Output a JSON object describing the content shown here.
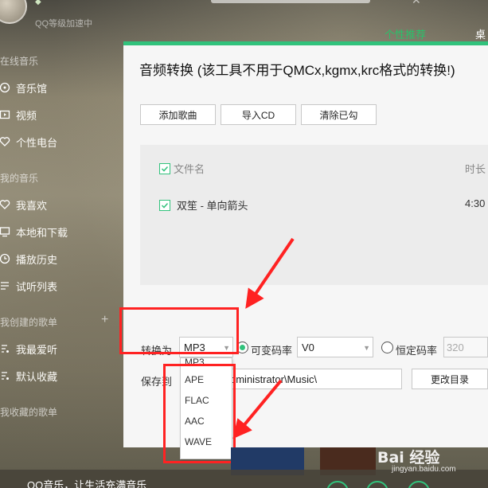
{
  "sidebar": {
    "vip_text": "QQ等级加速中",
    "sections": {
      "online": "在线音乐",
      "mine": "我的音乐",
      "created": "我创建的歌单",
      "collected": "我收藏的歌单"
    },
    "items": [
      {
        "label": "音乐馆",
        "icon": "music-hall-icon"
      },
      {
        "label": "视频",
        "icon": "video-icon"
      },
      {
        "label": "个性电台",
        "icon": "heart-radio-icon"
      },
      {
        "label": "我喜欢",
        "icon": "heart-icon"
      },
      {
        "label": "本地和下载",
        "icon": "monitor-icon"
      },
      {
        "label": "播放历史",
        "icon": "clock-icon"
      },
      {
        "label": "试听列表",
        "icon": "list-icon"
      },
      {
        "label": "我最爱听",
        "icon": "playlist-icon"
      },
      {
        "label": "默认收藏",
        "icon": "playlist-icon"
      }
    ]
  },
  "top": {
    "tab_recommend": "个性推荐",
    "tab_desktop": "桌"
  },
  "dialog": {
    "title": "音频转换 (该工具不用于QMCx,kgmx,krc格式的转换!)",
    "buttons": {
      "add_song": "添加歌曲",
      "import_cd": "导入CD",
      "clear_checked": "清除已勾"
    },
    "list": {
      "col_filename": "文件名",
      "col_duration": "时长",
      "rows": [
        {
          "name": "双笙 - 单向箭头",
          "duration": "4:30"
        }
      ]
    },
    "convert_label": "转换为",
    "format_value": "MP3",
    "vbr_label": "可变码率",
    "vbr_value": "V0",
    "cbr_label": "恒定码率",
    "cbr_value": "320",
    "save_label": "保存到",
    "save_path": "dministrator\\Music\\",
    "change_dir": "更改目录",
    "format_options": [
      "MP3",
      "APE",
      "FLAC",
      "AAC",
      "WAVE"
    ]
  },
  "bottom": {
    "slogan": "QQ音乐，让生活充满音乐"
  },
  "watermark": {
    "logo": "Bai 经验",
    "url": "jingyan.baidu.com"
  },
  "colors": {
    "accent": "#31c27c",
    "annotation": "#ff2222"
  }
}
